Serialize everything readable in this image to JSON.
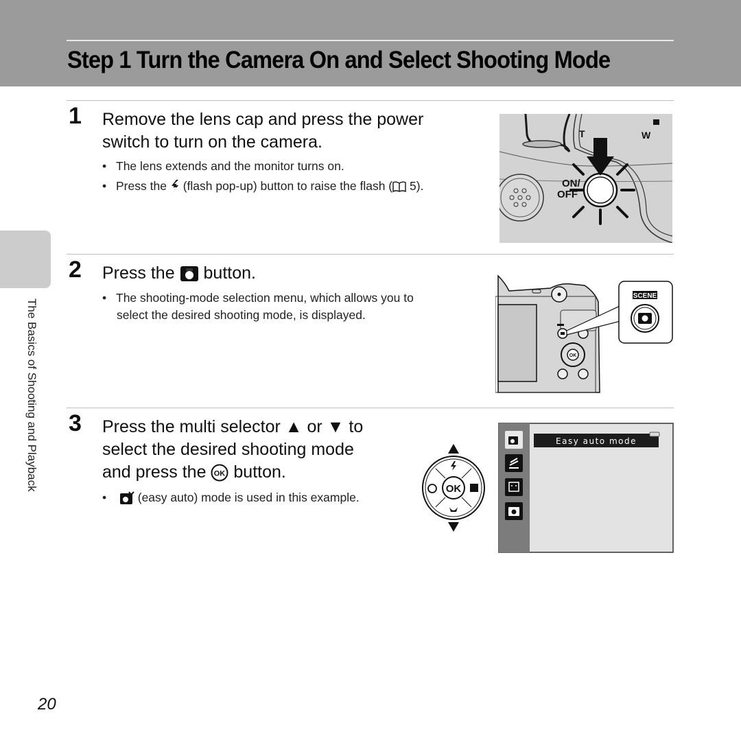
{
  "header": {
    "title": "Step 1 Turn the Camera On and Select Shooting Mode"
  },
  "side_tab": {
    "label": "The Basics of Shooting and Playback"
  },
  "steps": [
    {
      "number": "1",
      "heading_line1": "Remove the lens cap and press the power",
      "heading_line2": "switch to turn on the camera.",
      "bullets": [
        {
          "text": "The lens extends and the monitor turns on."
        },
        {
          "pre": "Press the",
          "icon": "flash-icon",
          "post": "(flash pop-up) button to raise the flash (",
          "ref_icon": "book-reference-icon",
          "ref": "5)."
        }
      ],
      "illustration": {
        "labels": {
          "on_off_top": "ON/",
          "on_off_bottom": "OFF",
          "tele": "T",
          "wide": "W"
        }
      }
    },
    {
      "number": "2",
      "heading_pre": "Press the",
      "heading_icon": "camera-shooting-mode-icon",
      "heading_post": "button.",
      "bullets": [
        {
          "line1": "The shooting-mode selection menu, which allows you to",
          "line2": "select the desired shooting mode, is displayed."
        }
      ],
      "illustration": {
        "callout_label": "SCENE",
        "ok_label": "OK"
      }
    },
    {
      "number": "3",
      "heading_line1_pre": "Press the multi selector",
      "up_symbol": "▲",
      "heading_line1_mid": "or",
      "down_symbol": "▼",
      "heading_line1_post": "to",
      "heading_line2": "select the desired shooting mode",
      "heading_line3_pre": "and press the",
      "ok_symbol": "OK",
      "heading_line3_post": "button.",
      "bullets": [
        {
          "icon": "easy-auto-icon",
          "text": "(easy auto) mode is used in this example."
        }
      ],
      "selector": {
        "center_label": "OK"
      },
      "screen": {
        "banner": "Easy auto mode",
        "modes": [
          "easy-auto",
          "scene",
          "smart-portrait",
          "auto"
        ],
        "selected_index": 0
      }
    }
  ],
  "footer": {
    "page_number": "20"
  }
}
